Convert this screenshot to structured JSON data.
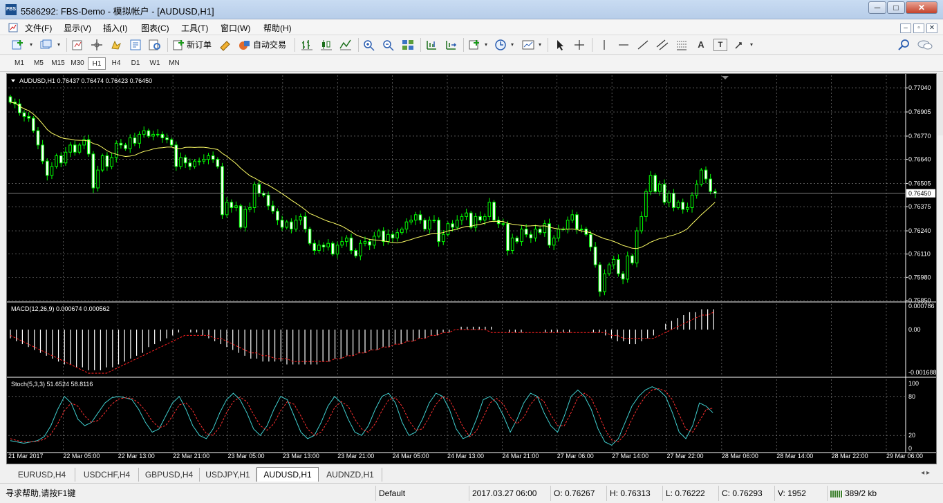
{
  "window": {
    "app_icon_text": "FBS",
    "title": "5586292: FBS-Demo - 模拟帐户 - [AUDUSD,H1]",
    "minimize": "─",
    "maximize": "□",
    "close": "✕"
  },
  "menu": {
    "items": [
      "文件(F)",
      "显示(V)",
      "插入(I)",
      "图表(C)",
      "工具(T)",
      "窗口(W)",
      "帮助(H)"
    ],
    "mdi": [
      "–",
      "▫",
      "✕"
    ]
  },
  "toolbar": {
    "new_order_label": "新订单",
    "auto_trade_label": "自动交易",
    "text_tool": "A",
    "label_tool": "T"
  },
  "timeframes": {
    "items": [
      "M1",
      "M5",
      "M15",
      "M30",
      "H1",
      "H4",
      "D1",
      "W1",
      "MN"
    ],
    "selected": "H1"
  },
  "chart": {
    "main_header": "AUDUSD,H1  0.76437 0.76474 0.76423 0.76450",
    "macd_header": "MACD(12,26,9) 0.000674 0.000562",
    "stoch_header": "Stoch(5,3,3) 51.6524 58.8116",
    "price_ticks": [
      "0.77040",
      "0.76905",
      "0.76770",
      "0.76640",
      "0.76505",
      "0.76375",
      "0.76240",
      "0.76110",
      "0.75980",
      "0.75850"
    ],
    "current_price": "0.76450",
    "macd_ticks": [
      "0.000786",
      "0.00",
      "-0.001688"
    ],
    "stoch_ticks": [
      "100",
      "80",
      "20",
      "0"
    ],
    "time_labels": [
      "21 Mar 2017",
      "22 Mar 05:00",
      "22 Mar 13:00",
      "22 Mar 21:00",
      "23 Mar 05:00",
      "23 Mar 13:00",
      "23 Mar 21:00",
      "24 Mar 05:00",
      "24 Mar 13:00",
      "24 Mar 21:00",
      "27 Mar 06:00",
      "27 Mar 14:00",
      "27 Mar 22:00",
      "28 Mar 06:00",
      "28 Mar 14:00",
      "28 Mar 22:00",
      "29 Mar 06:00"
    ],
    "colors": {
      "background": "#000000",
      "grid": "#ffffff",
      "candles": "#00ff00",
      "ma": "#ffff66",
      "macd_hist": "#ffffff",
      "macd_signal": "#ff2020",
      "stoch_main": "#40d0d0",
      "stoch_signal": "#ff3030",
      "axis_text": "#ffffff"
    }
  },
  "chart_data": {
    "type": "candlestick",
    "symbol": "AUDUSD",
    "timeframe": "H1",
    "ohlc_last": {
      "open": 0.76437,
      "high": 0.76474,
      "low": 0.76423,
      "close": 0.7645
    },
    "ylim": [
      0.7585,
      0.7711
    ],
    "close": [
      0.7696,
      0.7695,
      0.769,
      0.7688,
      0.7687,
      0.768,
      0.7672,
      0.7663,
      0.7655,
      0.766,
      0.7666,
      0.7662,
      0.7668,
      0.7672,
      0.7668,
      0.7672,
      0.7675,
      0.7667,
      0.7648,
      0.7658,
      0.7666,
      0.766,
      0.7665,
      0.7673,
      0.7672,
      0.767,
      0.7676,
      0.7673,
      0.7678,
      0.768,
      0.7677,
      0.7678,
      0.7678,
      0.7676,
      0.7675,
      0.7672,
      0.766,
      0.7665,
      0.7662,
      0.766,
      0.7663,
      0.7663,
      0.7664,
      0.7666,
      0.7664,
      0.766,
      0.7633,
      0.764,
      0.7637,
      0.7638,
      0.7626,
      0.7636,
      0.7637,
      0.765,
      0.7645,
      0.7644,
      0.7638,
      0.7635,
      0.763,
      0.7626,
      0.7629,
      0.7625,
      0.763,
      0.7632,
      0.7625,
      0.7617,
      0.7613,
      0.7616,
      0.7615,
      0.7617,
      0.7611,
      0.7616,
      0.7618,
      0.762,
      0.7613,
      0.761,
      0.7617,
      0.7618,
      0.7616,
      0.7621,
      0.7624,
      0.7618,
      0.7622,
      0.762,
      0.7623,
      0.7625,
      0.7629,
      0.763,
      0.7633,
      0.763,
      0.7625,
      0.763,
      0.763,
      0.7618,
      0.7622,
      0.7628,
      0.7626,
      0.763,
      0.7632,
      0.7634,
      0.7626,
      0.7632,
      0.763,
      0.7632,
      0.764,
      0.763,
      0.7628,
      0.7628,
      0.7613,
      0.762,
      0.7618,
      0.7625,
      0.7622,
      0.762,
      0.7625,
      0.7623,
      0.7628,
      0.7616,
      0.762,
      0.7625,
      0.7625,
      0.763,
      0.7633,
      0.7625,
      0.7625,
      0.7622,
      0.7615,
      0.7605,
      0.759,
      0.76,
      0.7605,
      0.7608,
      0.76,
      0.7597,
      0.761,
      0.7606,
      0.7624,
      0.7632,
      0.7646,
      0.7655,
      0.7646,
      0.765,
      0.764,
      0.7645,
      0.7637,
      0.764,
      0.7636,
      0.7637,
      0.7644,
      0.765,
      0.7658,
      0.7653,
      0.7646,
      0.7645
    ],
    "macd_hist": [
      -0.0003,
      -0.0004,
      -0.0005,
      -0.0006,
      -0.0007,
      -0.0008,
      -0.0009,
      -0.001,
      -0.0011,
      -0.0012,
      -0.0012,
      -0.0013,
      -0.0013,
      -0.0014,
      -0.0014,
      -0.0014,
      -0.0013,
      -0.0013,
      -0.0012,
      -0.0011,
      -0.001,
      -0.0009,
      -0.0008,
      -0.0006,
      -0.0005,
      -0.0004,
      -0.0003,
      -0.0002,
      -0.0001,
      0.0,
      -0.0001,
      -0.0001,
      -0.0002,
      -0.0003,
      -0.0004,
      -0.0005,
      -0.0006,
      -0.0007,
      -0.0008,
      -0.0009,
      -0.001,
      -0.001,
      -0.0011,
      -0.0011,
      -0.0011,
      -0.0011,
      -0.0012,
      -0.0012,
      -0.0012,
      -0.0012,
      -0.0012,
      -0.0012,
      -0.0011,
      -0.0011,
      -0.001,
      -0.001,
      -0.0009,
      -0.0009,
      -0.0008,
      -0.0008,
      -0.0007,
      -0.0007,
      -0.0006,
      -0.0006,
      -0.0005,
      -0.0005,
      -0.0004,
      -0.0004,
      -0.0003,
      -0.0003,
      -0.0002,
      -0.0002,
      -0.0001,
      -0.0001,
      0.0,
      0.0001,
      0.0001,
      0.0001,
      0.0001,
      0.0001,
      0.0001,
      0.0,
      0.0,
      -0.0001,
      -0.0001,
      -0.0001,
      0.0,
      0.0,
      0.0,
      -0.0001,
      -0.0001,
      -0.0001,
      -0.0001,
      -0.0001,
      0.0,
      0.0,
      0.0,
      -0.0001,
      -0.0001,
      -0.0002,
      -0.0003,
      -0.0004,
      -0.0004,
      -0.0005,
      -0.0005,
      -0.0004,
      -0.0003,
      -0.0002,
      0.0,
      0.0002,
      0.0003,
      0.0004,
      0.0005,
      0.0006,
      0.0006,
      0.0007,
      0.0007,
      0.0007
    ],
    "macd_signal": [
      -0.0002,
      -0.0003,
      -0.0004,
      -0.0005,
      -0.0006,
      -0.0007,
      -0.0008,
      -0.0009,
      -0.001,
      -0.0011,
      -0.0012,
      -0.0013,
      -0.0014,
      -0.0015,
      -0.0015,
      -0.0015,
      -0.0015,
      -0.0014,
      -0.0013,
      -0.0012,
      -0.0011,
      -0.001,
      -0.0009,
      -0.0008,
      -0.0007,
      -0.0006,
      -0.0005,
      -0.0004,
      -0.0003,
      -0.0002,
      -0.0002,
      -0.0002,
      -0.0002,
      -0.0002,
      -0.0003,
      -0.0003,
      -0.0004,
      -0.0005,
      -0.0006,
      -0.0007,
      -0.0008,
      -0.0008,
      -0.0009,
      -0.0009,
      -0.001,
      -0.001,
      -0.001,
      -0.0011,
      -0.0011,
      -0.0011,
      -0.0011,
      -0.0011,
      -0.0011,
      -0.0011,
      -0.001,
      -0.001,
      -0.0009,
      -0.0009,
      -0.0008,
      -0.0008,
      -0.0007,
      -0.0007,
      -0.0006,
      -0.0006,
      -0.0005,
      -0.0005,
      -0.0004,
      -0.0004,
      -0.0003,
      -0.0003,
      -0.0002,
      -0.0002,
      -0.0001,
      -0.0001,
      0.0,
      0.0,
      0.0,
      0.0,
      0.0,
      0.0,
      -0.0001,
      -0.0001,
      -0.0001,
      -0.0001,
      -0.0001,
      -0.0001,
      -0.0001,
      -0.0001,
      -0.0001,
      -0.0001,
      -0.0001,
      -0.0001,
      -0.0001,
      -0.0001,
      -0.0001,
      -0.0001,
      -0.0001,
      -0.0001,
      -0.0001,
      -0.0001,
      -0.0002,
      -0.0002,
      -0.0003,
      -0.0003,
      -0.0003,
      -0.0003,
      -0.0003,
      -0.0003,
      -0.0002,
      -0.0001,
      0.0,
      0.0001,
      0.0002,
      0.0003,
      0.0004,
      0.0005,
      0.0005,
      0.0006
    ],
    "macd_ylim": [
      -0.001688,
      0.000786
    ],
    "stoch_main": [
      12,
      10,
      8,
      10,
      12,
      18,
      35,
      60,
      80,
      70,
      45,
      35,
      40,
      55,
      70,
      78,
      80,
      78,
      75,
      60,
      40,
      25,
      30,
      50,
      70,
      80,
      60,
      35,
      20,
      15,
      30,
      55,
      75,
      85,
      75,
      55,
      30,
      20,
      35,
      60,
      80,
      75,
      50,
      25,
      15,
      20,
      40,
      65,
      80,
      70,
      45,
      25,
      20,
      35,
      60,
      80,
      85,
      70,
      40,
      20,
      25,
      45,
      70,
      85,
      80,
      60,
      30,
      15,
      20,
      45,
      75,
      80,
      70,
      50,
      25,
      45,
      70,
      85,
      80,
      55,
      35,
      25,
      50,
      80,
      90,
      80,
      60,
      30,
      10,
      5,
      15,
      40,
      65,
      80,
      90,
      95,
      90,
      80,
      55,
      25,
      15,
      35,
      70,
      65,
      55
    ],
    "stoch_signal": [
      15,
      12,
      10,
      10,
      11,
      14,
      22,
      38,
      58,
      70,
      65,
      50,
      40,
      43,
      55,
      68,
      76,
      78,
      77,
      70,
      58,
      42,
      32,
      35,
      50,
      67,
      70,
      58,
      38,
      23,
      20,
      33,
      55,
      72,
      79,
      72,
      52,
      35,
      28,
      38,
      58,
      72,
      68,
      50,
      30,
      20,
      25,
      42,
      63,
      72,
      65,
      45,
      30,
      25,
      38,
      58,
      75,
      78,
      65,
      43,
      28,
      30,
      48,
      68,
      80,
      75,
      55,
      33,
      18,
      27,
      48,
      70,
      77,
      68,
      48,
      38,
      48,
      68,
      80,
      72,
      52,
      35,
      35,
      55,
      78,
      85,
      77,
      55,
      30,
      13,
      10,
      22,
      45,
      65,
      80,
      90,
      92,
      88,
      75,
      52,
      30,
      25,
      42,
      60,
      62
    ]
  },
  "tabs": {
    "items": [
      "EURUSD,H4",
      "USDCHF,H4",
      "GBPUSD,H4",
      "USDJPY,H1",
      "AUDUSD,H1",
      "AUDNZD,H1"
    ],
    "active": "AUDUSD,H1",
    "scroll": "◂ ▸"
  },
  "status": {
    "help": "寻求帮助,请按F1键",
    "profile": "Default",
    "datetime": "2017.03.27 06:00",
    "open": "O: 0.76267",
    "high": "H: 0.76313",
    "low": "L: 0.76222",
    "close": "C: 0.76293",
    "volume": "V: 1952",
    "traffic": "389/2 kb"
  }
}
